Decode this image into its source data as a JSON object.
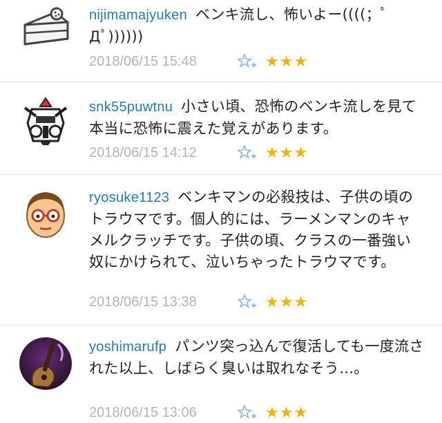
{
  "comments": [
    {
      "username": "nijimamajyuken",
      "text": "ベンキ流し、怖いよー((((；ﾟДﾟ))))))",
      "timestamp": "2018/06/15 15:48",
      "stars": "★★★",
      "avatar": "cake-slice-icon"
    },
    {
      "username": "snk55puwtnu",
      "text": "小さい頃、恐怖のベンキ流しを見て本当に恐怖に震えた覚えがあります。",
      "timestamp": "2018/06/15 14:12",
      "stars": "★★★",
      "avatar": "robot-head-icon"
    },
    {
      "username": "ryosuke1123",
      "text": "ベンキマンの必殺技は、子供の頃のトラウマです。個人的には、ラーメンマンのキャメルクラッチです。子供の頃、クラスの一番強い奴にかけられて、泣いちゃったトラウマです。",
      "timestamp": "2018/06/15 13:38",
      "stars": "★★★",
      "avatar": "glasses-face-icon"
    },
    {
      "username": "yoshimarufp",
      "text": "パンツ突っ込んで復活しても一度流された以上、しばらく臭いは取れなそう…。",
      "timestamp": "2018/06/15 13:06",
      "stars": "★★★",
      "avatar": "guitar-photo-icon"
    }
  ],
  "colors": {
    "username": "#1f7fa6",
    "timestamp": "#b4b4b4",
    "star": "#f0b400",
    "fav_icon": "#8fb4d8"
  }
}
